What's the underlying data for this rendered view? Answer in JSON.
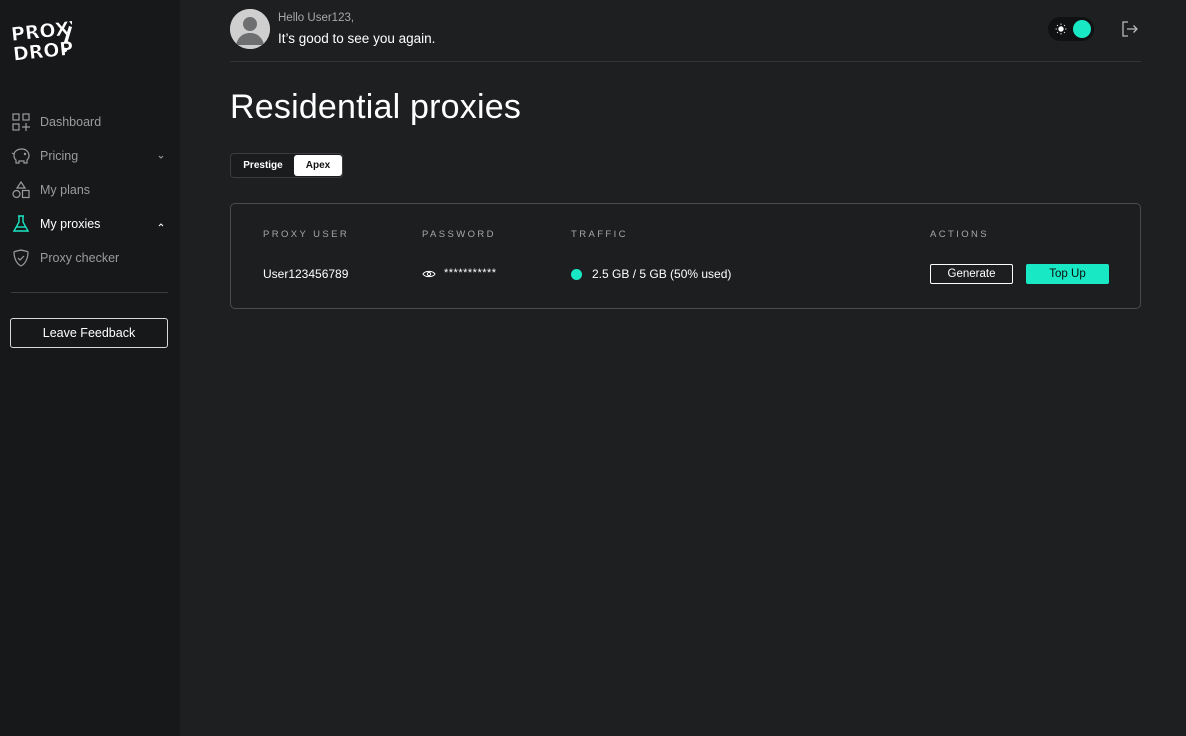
{
  "brand": {
    "logo_text": "PROXY DROP!",
    "accent_color": "#19e8c4"
  },
  "sidebar": {
    "items": [
      {
        "label": "Dashboard",
        "icon": "grid-plus-icon",
        "active": false
      },
      {
        "label": "Pricing",
        "icon": "piggy-bank-icon",
        "active": false,
        "chevron": "down"
      },
      {
        "label": "My plans",
        "icon": "shapes-icon",
        "active": false
      },
      {
        "label": "My proxies",
        "icon": "flask-icon",
        "active": true,
        "chevron": "up"
      },
      {
        "label": "Proxy checker",
        "icon": "shield-check-icon",
        "active": false
      }
    ],
    "feedback_label": "Leave Feedback"
  },
  "header": {
    "greeting_small": "Hello User123,",
    "greeting_main": "It’s good to see you again.",
    "theme_toggle": {
      "icon": "sun-icon",
      "state": "on"
    },
    "logout_icon": "logout-icon"
  },
  "page": {
    "title": "Residential proxies",
    "tabs": [
      {
        "label": "Prestige",
        "selected": false
      },
      {
        "label": "Apex",
        "selected": true
      }
    ]
  },
  "proxy_table": {
    "columns": [
      "PROXY USER",
      "PASSWORD",
      "TRAFFIC",
      "ACTIONS"
    ],
    "rows": [
      {
        "user": "User123456789",
        "password_mask": "***********",
        "traffic": "2.5 GB / 5 GB (50% used)",
        "actions": {
          "generate": "Generate",
          "top_up": "Top Up"
        }
      }
    ]
  }
}
